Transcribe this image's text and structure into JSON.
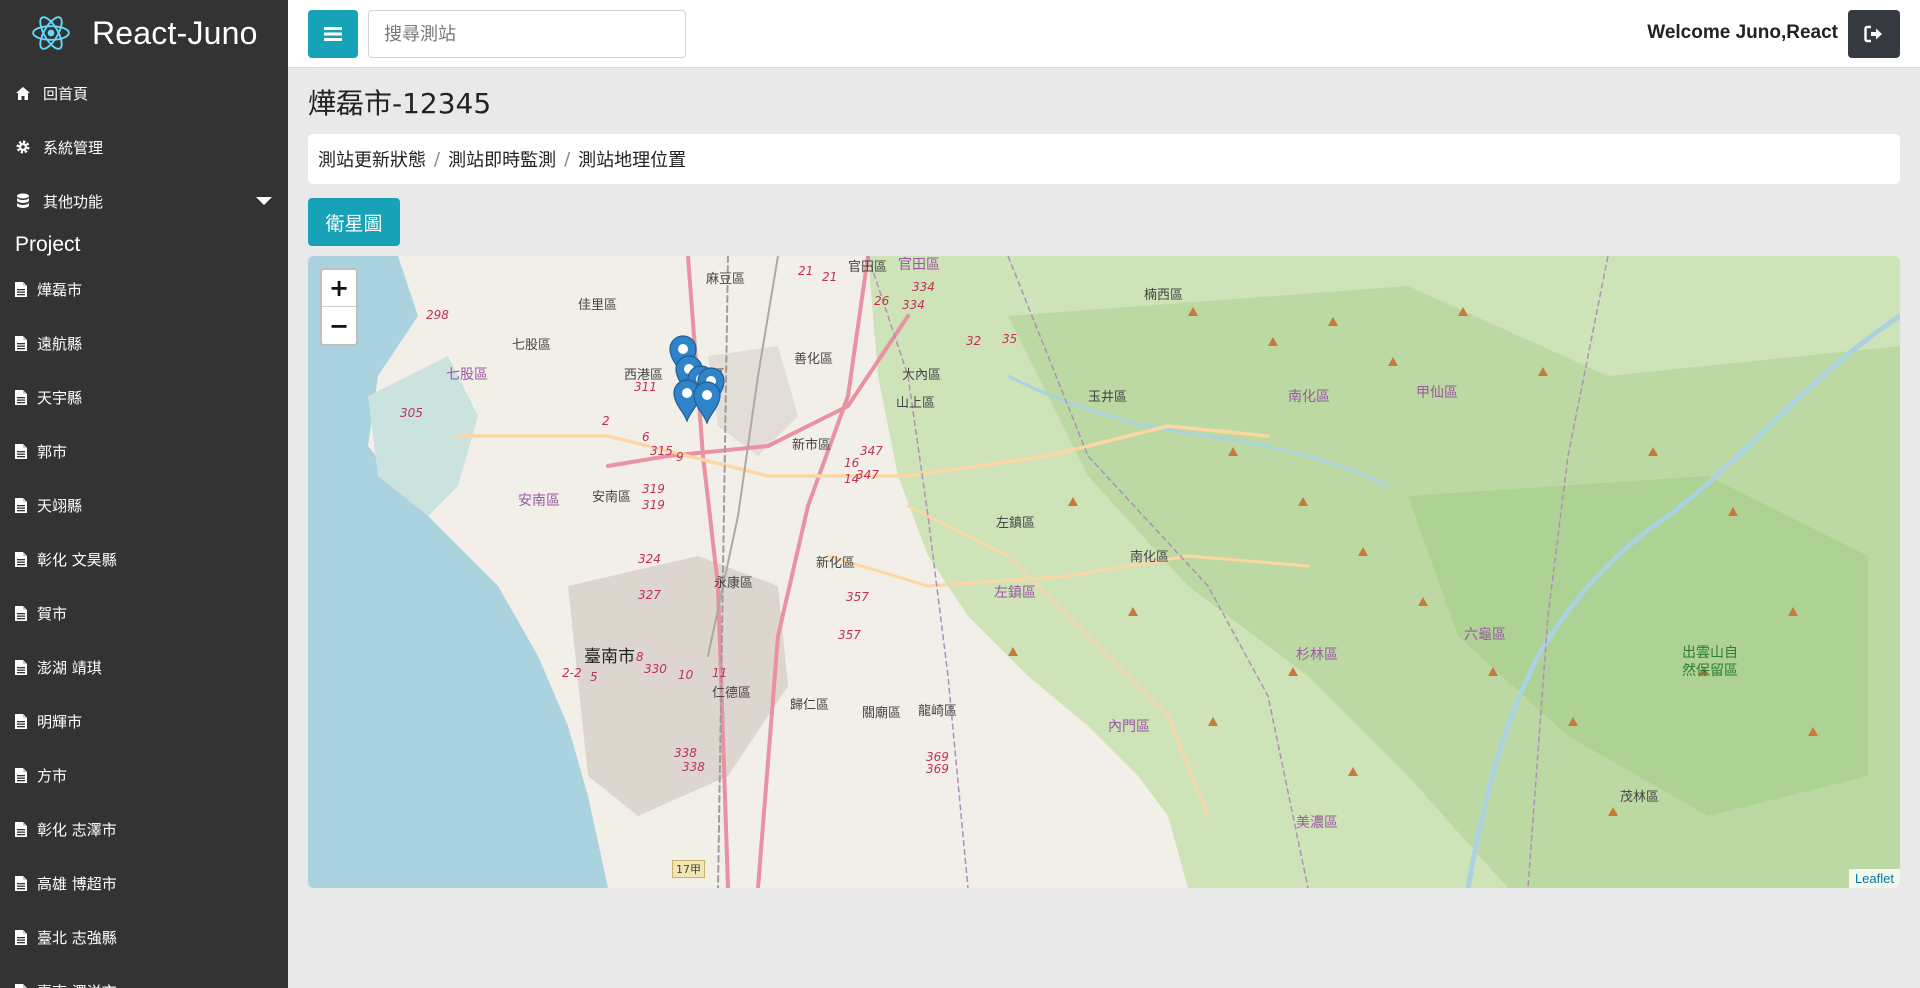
{
  "brand": {
    "name": "React-Juno",
    "logo_icon": "react-logo-icon"
  },
  "sidebar": {
    "nav": [
      {
        "label": "回首頁",
        "icon": "home-icon"
      },
      {
        "label": "系統管理",
        "icon": "gear-icon"
      },
      {
        "label": "其他功能",
        "icon": "database-icon"
      }
    ],
    "section_title": "Project",
    "projects": [
      "燁磊市",
      "遠航縣",
      "天宇縣",
      "郭市",
      "天翊縣",
      "彰化 文昊縣",
      "賀市",
      "澎湖 靖琪",
      "明輝市",
      "方市",
      "彰化 志澤市",
      "高雄 博超市",
      "臺北 志強縣",
      "臺南 澤洋市"
    ]
  },
  "header": {
    "search_placeholder": "搜尋測站",
    "welcome": "Welcome Juno,React"
  },
  "main": {
    "title": "燁磊市-12345",
    "breadcrumb": [
      "測站更新狀態",
      "測站即時監測",
      "測站地理位置"
    ],
    "satellite_button": "衛星圖"
  },
  "map": {
    "zoom_in": "+",
    "zoom_out": "−",
    "attribution": "Leaflet",
    "labels": {
      "tainan": "臺南市",
      "madou": "麻豆區",
      "jiali": "佳里區",
      "qigu": "七股區",
      "qigu2": "七股區",
      "xigang": "西港區",
      "anding": "安定區",
      "shanhua": "善化區",
      "danei": "大內區",
      "shanshang": "山上區",
      "xinshi": "新市區",
      "annan": "安南區",
      "annan2": "安南區",
      "yongkang": "永康區",
      "xinhua": "新化區",
      "zuozhen": "左鎮區",
      "zuozhen2": "左鎮區",
      "guiren": "歸仁區",
      "rende": "仁德區",
      "guanmiao": "關廟區",
      "longqi": "龍崎區",
      "yujing": "玉井區",
      "nanhua": "南化區",
      "nanhua2": "南化區",
      "jiaxian": "甲仙區",
      "nanxi": "楠西區",
      "guantian": "官田區",
      "guantian2": "官田區",
      "shanlin": "杉林區",
      "liugui": "六龜區",
      "neimen": "內門區",
      "meinong": "美濃區",
      "maolin": "茂林區",
      "chuyun": "出雲山自",
      "chuyun2": "然保留區",
      "road17": "17甲"
    },
    "routes": [
      "298",
      "305",
      "2",
      "6",
      "315",
      "9",
      "311",
      "319",
      "319",
      "324",
      "327",
      "8",
      "330",
      "10",
      "11",
      "2-2",
      "5",
      "338",
      "338",
      "369",
      "369",
      "357",
      "357",
      "16",
      "14",
      "347",
      "347",
      "21",
      "21",
      "26",
      "334",
      "334",
      "32",
      "35"
    ],
    "marker_count": 6
  }
}
